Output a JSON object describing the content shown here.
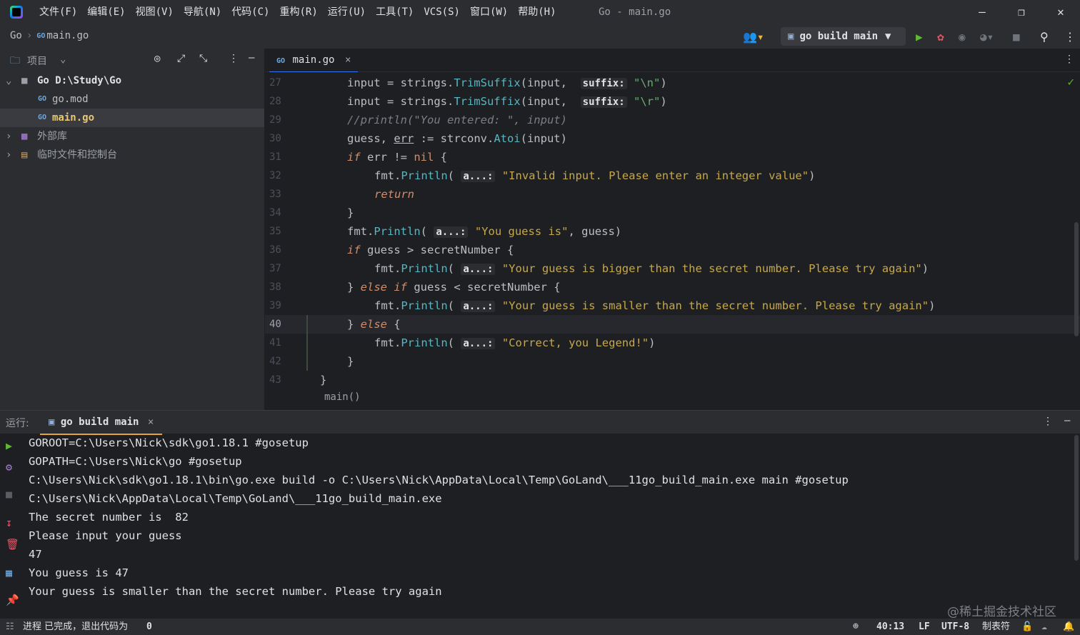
{
  "menus": [
    "文件(F)",
    "编辑(E)",
    "视图(V)",
    "导航(N)",
    "代码(C)",
    "重构(R)",
    "运行(U)",
    "工具(T)",
    "VCS(S)",
    "窗口(W)",
    "帮助(H)"
  ],
  "window_title": "Go - main.go",
  "nav": {
    "project": "Go",
    "separator": "›",
    "file": "main.go"
  },
  "run_config": "go build main",
  "project_panel": {
    "title": "项目",
    "items": [
      {
        "label": "Go  D:\\Study\\Go"
      },
      {
        "label": "go.mod"
      },
      {
        "label": "main.go"
      },
      {
        "label": "外部库"
      },
      {
        "label": "临时文件和控制台"
      }
    ]
  },
  "editor": {
    "tab": "main.go",
    "close": "×",
    "line_numbers": [
      "27",
      "28",
      "29",
      "30",
      "31",
      "32",
      "33",
      "34",
      "35",
      "36",
      "37",
      "38",
      "39",
      "40",
      "41",
      "42",
      "43"
    ],
    "current_line": "40",
    "code": {
      "l27": {
        "a": "input = strings.",
        "fn": "TrimSuffix",
        "b": "(input, ",
        "hint": "suffix:",
        "s": "\"\\n\"",
        "c": ")"
      },
      "l28": {
        "a": "input = strings.",
        "fn": "TrimSuffix",
        "b": "(input, ",
        "hint": "suffix:",
        "s": "\"\\r\"",
        "c": ")"
      },
      "l29": "//println(\"You entered: \", input)",
      "l30": {
        "a": "guess, ",
        "u": "err",
        "b": " := strconv.",
        "fn": "Atoi",
        "c": "(input)"
      },
      "l31": {
        "kw": "if",
        "a": " err != ",
        "kw2": "nil",
        "b": " {"
      },
      "l32": {
        "a": "fmt.",
        "fn": "Println",
        "b": "( ",
        "hint": "a...:",
        "s": "\"Invalid input. Please enter an integer value\"",
        "c": ")"
      },
      "l33": "return",
      "l34": "}",
      "l35": {
        "a": "fmt.",
        "fn": "Println",
        "b": "( ",
        "hint": "a...:",
        "s": "\"You guess is\"",
        "c": ", guess)"
      },
      "l36": {
        "kw": "if",
        "a": " guess > secretNumber {"
      },
      "l37": {
        "a": "fmt.",
        "fn": "Println",
        "b": "( ",
        "hint": "a...:",
        "s": "\"Your guess is bigger than the secret number. Please try again\"",
        "c": ")"
      },
      "l38": {
        "a": "} ",
        "kw": "else if",
        "b": " guess < secretNumber {"
      },
      "l39": {
        "a": "fmt.",
        "fn": "Println",
        "b": "( ",
        "hint": "a...:",
        "s": "\"Your guess is smaller than the secret number. Please try again\"",
        "c": ")"
      },
      "l40": {
        "a": "} ",
        "kw": "else",
        "b": " {"
      },
      "l41": {
        "a": "fmt.",
        "fn": "Println",
        "b": "( ",
        "hint": "a...:",
        "s": "\"Correct, you Legend!\"",
        "c": ")"
      },
      "l42": "}",
      "l43": "}"
    },
    "function_breadcrumb": "main()"
  },
  "run_panel": {
    "label": "运行:",
    "tab": "go build main",
    "close": "×",
    "lines": [
      "GOROOT=C:\\Users\\Nick\\sdk\\go1.18.1 #gosetup",
      "GOPATH=C:\\Users\\Nick\\go #gosetup",
      "C:\\Users\\Nick\\sdk\\go1.18.1\\bin\\go.exe build -o C:\\Users\\Nick\\AppData\\Local\\Temp\\GoLand\\___11go_build_main.exe main #gosetup",
      "C:\\Users\\Nick\\AppData\\Local\\Temp\\GoLand\\___11go_build_main.exe",
      "The secret number is  82",
      "Please input your guess",
      "47",
      "You guess is 47",
      "Your guess is smaller than the secret number. Please try again"
    ]
  },
  "status": {
    "process": "进程 已完成，退出代码为",
    "exit_code": "0",
    "position": "40:13",
    "line_sep": "LF",
    "encoding": "UTF-8",
    "indent": "制表符"
  },
  "watermark": "@稀土掘金技术社区",
  "colors": {
    "accent": "#3574f0",
    "run_green": "#5fb832",
    "debug_red": "#e55765"
  }
}
